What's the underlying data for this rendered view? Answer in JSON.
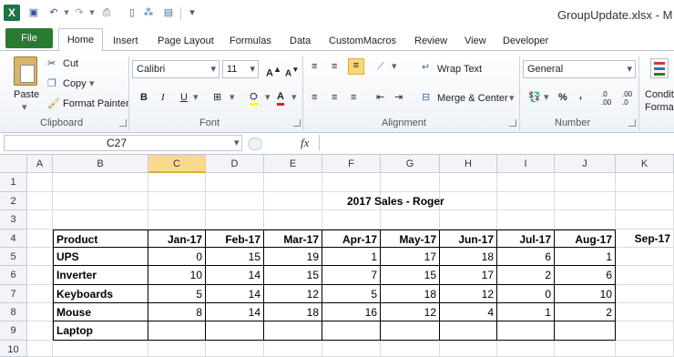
{
  "window": {
    "title": "GroupUpdate.xlsx - M"
  },
  "ribbon_tabs": [
    "File",
    "Home",
    "Insert",
    "Page Layout",
    "Formulas",
    "Data",
    "CustomMacros",
    "Review",
    "View",
    "Developer"
  ],
  "clipboard": {
    "paste": "Paste",
    "cut": "Cut",
    "copy": "Copy",
    "format_painter": "Format Painter",
    "group": "Clipboard"
  },
  "font": {
    "name": "Calibri",
    "size": "11",
    "group": "Font",
    "bold": "B",
    "italic": "I",
    "underline": "U"
  },
  "alignment": {
    "wrap": "Wrap Text",
    "merge": "Merge & Center",
    "group": "Alignment"
  },
  "number": {
    "format": "General",
    "percent": "%",
    "comma": ",",
    "group": "Number",
    "inc": ".0 .00",
    "dec": ".00 .0"
  },
  "styles": {
    "cond1": "Conditi",
    "cond2": "Formatt"
  },
  "formula_bar": {
    "name_box": "C27",
    "fx": "fx",
    "formula": ""
  },
  "columns": [
    "A",
    "B",
    "C",
    "D",
    "E",
    "F",
    "G",
    "H",
    "I",
    "J",
    "K"
  ],
  "rows": [
    "1",
    "2",
    "3",
    "4",
    "5",
    "6",
    "7",
    "8",
    "9",
    "10"
  ],
  "sheet": {
    "title": "2017 Sales - Roger",
    "header": [
      "Product",
      "Jan-17",
      "Feb-17",
      "Mar-17",
      "Apr-17",
      "May-17",
      "Jun-17",
      "Jul-17",
      "Aug-17",
      "Sep-17"
    ],
    "data": [
      [
        "UPS",
        "0",
        "15",
        "19",
        "1",
        "17",
        "18",
        "6",
        "1"
      ],
      [
        "Inverter",
        "10",
        "14",
        "15",
        "7",
        "15",
        "17",
        "2",
        "6"
      ],
      [
        "Keyboards",
        "5",
        "14",
        "12",
        "5",
        "18",
        "12",
        "0",
        "10"
      ],
      [
        "Mouse",
        "8",
        "14",
        "18",
        "16",
        "12",
        "4",
        "1",
        "2"
      ],
      [
        "Laptop",
        "",
        "",
        "",
        "",
        "",
        "",
        "",
        ""
      ]
    ]
  }
}
